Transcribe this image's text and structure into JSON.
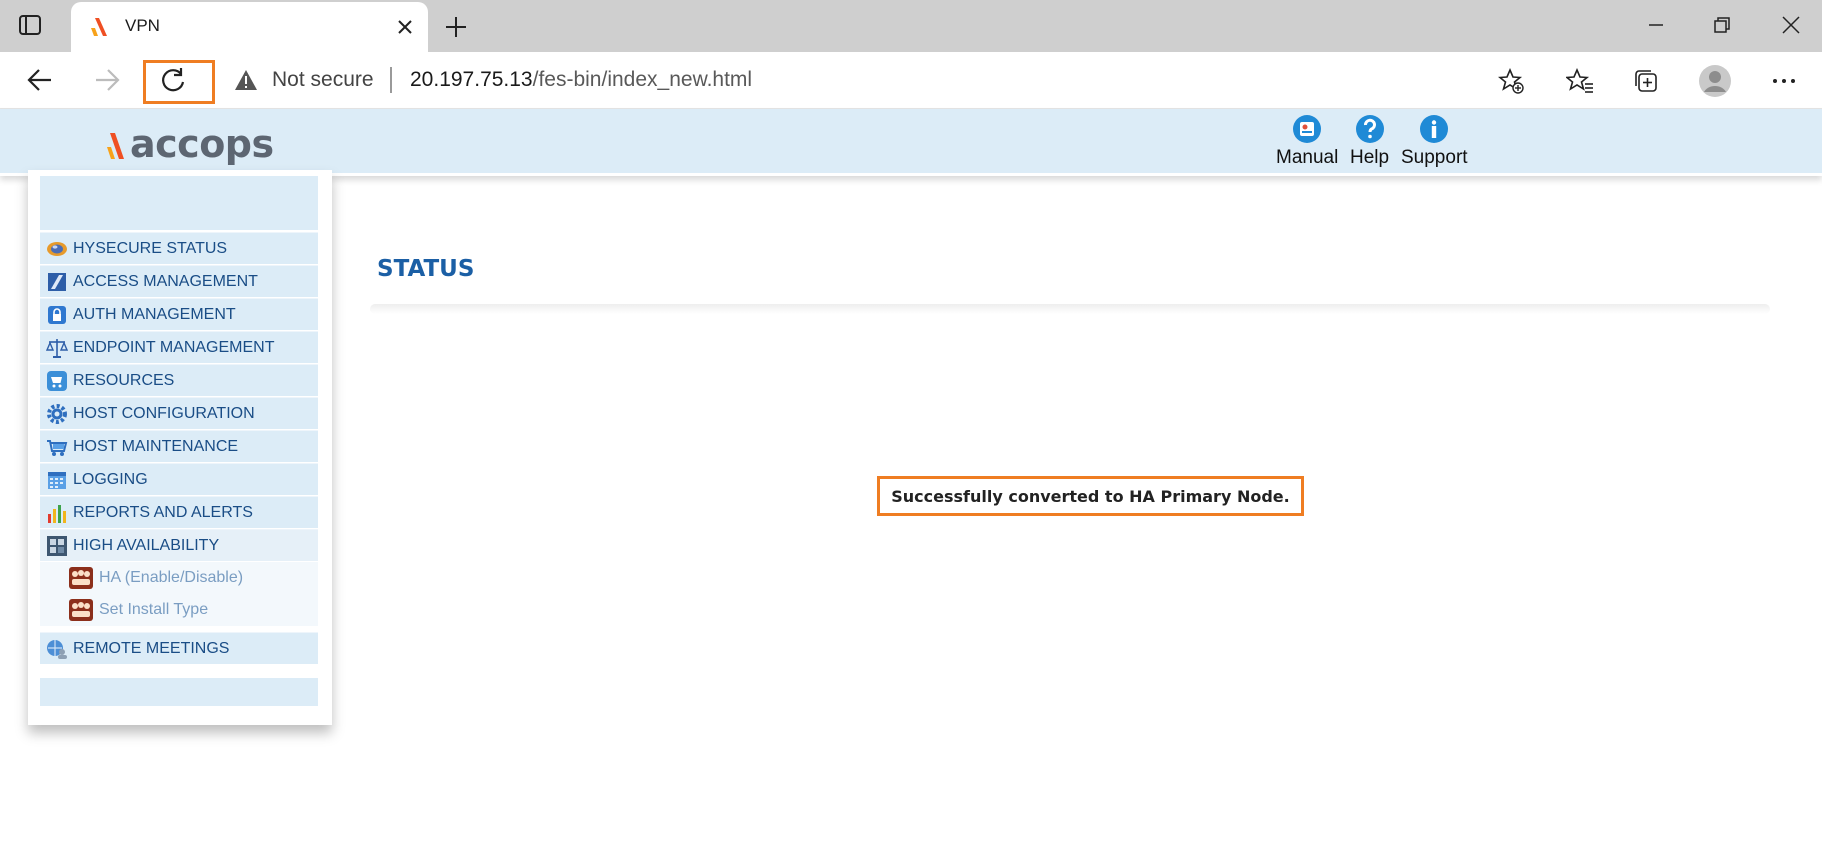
{
  "browser": {
    "tab_title": "VPN",
    "security_label": "Not secure",
    "url_host": "20.197.75.13",
    "url_path": "/fes-bin/index_new.html"
  },
  "app": {
    "logo_text": "accops",
    "header_links": [
      {
        "label": "Manual",
        "icon": "manual-icon"
      },
      {
        "label": "Help",
        "icon": "help-icon"
      },
      {
        "label": "Support",
        "icon": "info-icon"
      }
    ]
  },
  "sidebar": {
    "items": [
      {
        "label": "HYSECURE STATUS",
        "icon": "status-icon"
      },
      {
        "label": "ACCESS MANAGEMENT",
        "icon": "access-icon"
      },
      {
        "label": "AUTH MANAGEMENT",
        "icon": "lock-icon"
      },
      {
        "label": "ENDPOINT MANAGEMENT",
        "icon": "scale-icon"
      },
      {
        "label": "RESOURCES",
        "icon": "cart-icon"
      },
      {
        "label": "HOST CONFIGURATION",
        "icon": "gear-icon"
      },
      {
        "label": "HOST MAINTENANCE",
        "icon": "maintenance-icon"
      },
      {
        "label": "LOGGING",
        "icon": "calendar-icon"
      },
      {
        "label": "REPORTS AND ALERTS",
        "icon": "bar-chart-icon"
      },
      {
        "label": "HIGH AVAILABILITY",
        "icon": "network-icon"
      }
    ],
    "sub_items": [
      {
        "label": "HA (Enable/Disable)",
        "icon": "group-icon"
      },
      {
        "label": "Set Install Type",
        "icon": "group-icon"
      }
    ],
    "last_item": {
      "label": "REMOTE MEETINGS",
      "icon": "globe-people-icon"
    }
  },
  "main": {
    "title": "STATUS",
    "message": "Successfully converted to HA Primary Node."
  },
  "colors": {
    "accent_highlight": "#ef7d22",
    "header_bg": "#dcecf7",
    "menu_text": "#1a4d86",
    "title_text": "#1b5fa5"
  }
}
